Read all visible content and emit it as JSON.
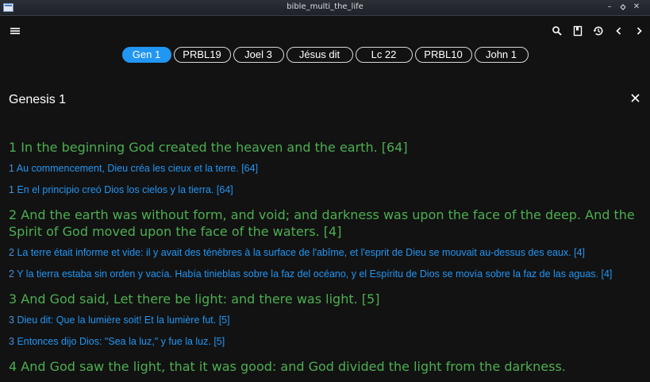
{
  "window": {
    "title": "bible_multi_the_life"
  },
  "toolbar": {
    "left_icon": "hamburger-menu-icon",
    "right_icons": [
      "search-icon",
      "bookmark-icon",
      "history-icon",
      "chevron-left-icon",
      "chevron-right-icon"
    ]
  },
  "tabs": [
    {
      "label": "Gen 1",
      "active": true
    },
    {
      "label": "PRBL19"
    },
    {
      "label": "Joel 3"
    },
    {
      "label": "Jésus dit"
    },
    {
      "label": "Lc 22"
    },
    {
      "label": "PRBL10"
    },
    {
      "label": "John 1"
    }
  ],
  "chapter": {
    "title": "Genesis 1"
  },
  "colors": {
    "english": "#4caf50",
    "translation": "#2196f3",
    "accent": "#2196f3",
    "background": "#121212"
  },
  "verses": [
    {
      "en": {
        "num": "1",
        "text": "In the beginning God created the heaven and the earth. [64]"
      },
      "fr": {
        "num": "1",
        "text": "Au commencement, Dieu créa les cieux et la terre. [64]"
      },
      "es": {
        "num": "1",
        "text": "En el principio creó Dios los cielos y la tierra. [64]"
      }
    },
    {
      "en": {
        "num": "2",
        "text": "And the earth was without form, and void; and darkness was upon the face of the deep. And the Spirit of God moved upon the face of the waters. [4]"
      },
      "fr": {
        "num": "2",
        "text": "La terre était informe et vide: il y avait des ténèbres à la surface de l'abîme, et l'esprit de Dieu se mouvait au-dessus des eaux. [4]"
      },
      "es": {
        "num": "2",
        "text": "Y la tierra estaba sin orden y vacía. Había tinieblas sobre la faz del océano, y el Espíritu de Dios se movía sobre la faz de las aguas. [4]"
      }
    },
    {
      "en": {
        "num": "3",
        "text": "And God said, Let there be light: and there was light. [5]"
      },
      "fr": {
        "num": "3",
        "text": "Dieu dit: Que la lumière soit! Et la lumière fut. [5]"
      },
      "es": {
        "num": "3",
        "text": "Entonces dijo Dios: \"Sea la luz,\" y fue la luz. [5]"
      }
    },
    {
      "en": {
        "num": "4",
        "text": "And God saw the light, that it was good: and God divided the light from the darkness."
      }
    }
  ]
}
